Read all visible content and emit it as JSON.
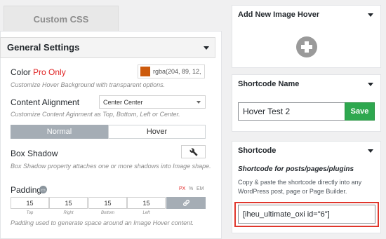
{
  "tabs": {
    "custom_css": "Custom CSS"
  },
  "general": {
    "title": "General Settings",
    "color": {
      "label": "Color",
      "pro_badge": "Pro Only",
      "swatch_color": "#cc5a0c",
      "value": "rgba(204, 89, 12,",
      "hint": "Customize Hover Background with transparent options."
    },
    "content_alignment": {
      "label": "Content Alignment",
      "selected": "Center Center",
      "hint": "Customize Content Aginment as Top, Bottom, Left or Center."
    },
    "state_toggle": {
      "normal": "Normal",
      "hover": "Hover",
      "active": "Normal"
    },
    "box_shadow": {
      "label": "Box Shadow",
      "icon": "wrench-icon",
      "hint": "Box Shadow property attaches one or more shadows into Image shape."
    },
    "padding": {
      "label": "Padding",
      "units": [
        "PX",
        "%",
        "EM"
      ],
      "active_unit": "PX",
      "top": "15",
      "right": "15",
      "bottom": "15",
      "left": "15",
      "captions": {
        "top": "Top",
        "right": "Right",
        "bottom": "Bottom",
        "left": "Left"
      },
      "hint": "Padding used to generate space around an Image Hover content."
    }
  },
  "add_new": {
    "title": "Add New Image Hover",
    "icon": "plus-circle-icon"
  },
  "shortcode_name": {
    "title": "Shortcode Name",
    "value": "Hover Test 2",
    "save_label": "Save"
  },
  "shortcode": {
    "title": "Shortcode",
    "subtitle": "Shortcode for posts/pages/plugins",
    "description": "Copy & paste the shortcode directly into any WordPress post, page or Page Builder.",
    "value": "[iheu_ultimate_oxi id=\"6\"]"
  },
  "colors": {
    "save_green": "#2ea84f",
    "pro_red": "#e02424",
    "highlight_red": "#e0362c",
    "segment_active": "#a5adb5"
  }
}
